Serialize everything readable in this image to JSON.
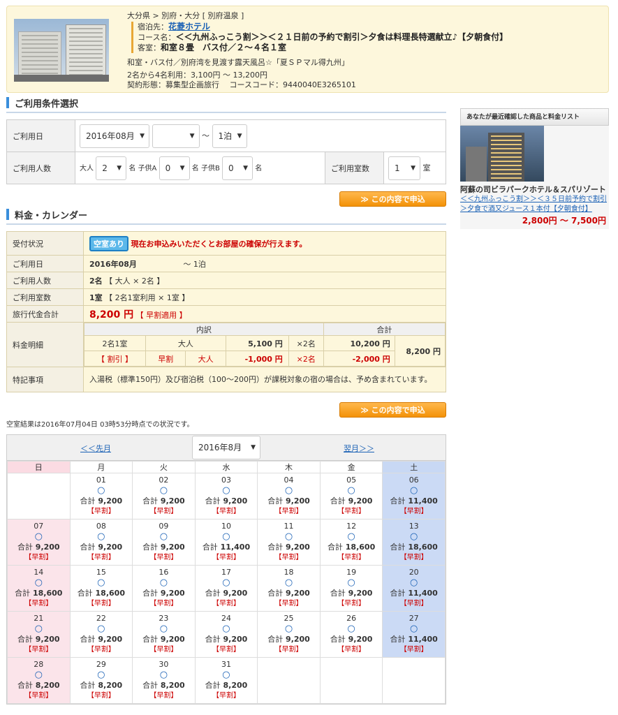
{
  "header": {
    "breadcrumb": "大分県 > 別府・大分 [ 別府温泉 ]",
    "hotel_label": "宿泊先：",
    "hotel_name": "花菱ホテル",
    "course_label": "コース名：",
    "course_name": "＜＜九州ふっこう割＞＞＜２１日前の予約で割引＞夕食は料理長特選献立♪【夕朝食付】",
    "room_label": "客室：",
    "room_name": "和室８畳　バス付／２～４名１室",
    "room_desc": "和室・バス付／別府湾を見渡す露天風呂☆「夏ＳＰマル得九州」",
    "price_range": "2名から4名利用：3,100円 ～ 13,200円",
    "contract": "契約形態：募集型企画旅行　 コースコード：9440040E3265101"
  },
  "conditions": {
    "title": "ご利用条件選択",
    "date_label": "ご利用日",
    "month_value": "2016年08月",
    "day_value": "",
    "tilde": "～",
    "nights_value": "1泊",
    "people_label": "ご利用人数",
    "adult_label": "大人",
    "adult_value": "2",
    "childA_label": "子供A",
    "childA_value": "0",
    "childB_label": "子供B",
    "childB_value": "0",
    "unit_name": "名",
    "rooms_label": "ご利用室数",
    "rooms_value": "1",
    "unit_room": "室",
    "apply_label": "この内容で申込"
  },
  "fee": {
    "title": "料金・カレンダー",
    "status_label": "受付状況",
    "vacant_badge": "空室あり",
    "status_text": "現在お申込みいただくとお部屋の確保が行えます。",
    "date_label": "ご利用日",
    "date_value": "2016年08月",
    "date_suffix": "～ 1泊",
    "people_label": "ご利用人数",
    "people_value": "2名",
    "people_detail": "【 大人 × 2名 】",
    "rooms_label": "ご利用室数",
    "rooms_value": "1室",
    "rooms_detail": "【 2名1室利用 × 1室 】",
    "total_label": "旅行代金合計",
    "total_value": "8,200 円",
    "total_note": "【 早割適用 】",
    "breakdown_label": "料金明細",
    "breakdown_header": "内訳",
    "sum_header": "合計",
    "row1": [
      "2名1室",
      "大人",
      "5,100 円",
      "×2名",
      "10,200 円"
    ],
    "row2": [
      "【 割引 】",
      "早割",
      "大人",
      "-1,000 円",
      "×2名",
      "-2,000 円"
    ],
    "grand_total": "8,200 円",
    "notes_label": "特記事項",
    "notes_text": "入湯税（標準150円）及び宿泊税（100～200円）が課税対象の宿の場合は、予め含まれています。"
  },
  "status_note": "空室結果は2016年07月04日 03時53分時点での状況です。",
  "calendar": {
    "prev": "＜＜先月",
    "next": "翌月＞＞",
    "month": "2016年8月",
    "weekdays": [
      "日",
      "月",
      "火",
      "水",
      "木",
      "金",
      "土"
    ],
    "avail": "○",
    "early": "【早割】",
    "total_prefix": "合計",
    "days": [
      {
        "d": "",
        "t": ""
      },
      {
        "d": "01",
        "t": "9,200"
      },
      {
        "d": "02",
        "t": "9,200"
      },
      {
        "d": "03",
        "t": "9,200"
      },
      {
        "d": "04",
        "t": "9,200"
      },
      {
        "d": "05",
        "t": "9,200"
      },
      {
        "d": "06",
        "t": "11,400"
      },
      {
        "d": "07",
        "t": "9,200"
      },
      {
        "d": "08",
        "t": "9,200"
      },
      {
        "d": "09",
        "t": "9,200"
      },
      {
        "d": "10",
        "t": "11,400"
      },
      {
        "d": "11",
        "t": "9,200"
      },
      {
        "d": "12",
        "t": "18,600"
      },
      {
        "d": "13",
        "t": "18,600"
      },
      {
        "d": "14",
        "t": "18,600"
      },
      {
        "d": "15",
        "t": "18,600"
      },
      {
        "d": "16",
        "t": "9,200"
      },
      {
        "d": "17",
        "t": "9,200"
      },
      {
        "d": "18",
        "t": "9,200"
      },
      {
        "d": "19",
        "t": "9,200"
      },
      {
        "d": "20",
        "t": "11,400"
      },
      {
        "d": "21",
        "t": "9,200"
      },
      {
        "d": "22",
        "t": "9,200"
      },
      {
        "d": "23",
        "t": "9,200"
      },
      {
        "d": "24",
        "t": "9,200"
      },
      {
        "d": "25",
        "t": "9,200"
      },
      {
        "d": "26",
        "t": "9,200"
      },
      {
        "d": "27",
        "t": "11,400"
      },
      {
        "d": "28",
        "t": "8,200"
      },
      {
        "d": "29",
        "t": "8,200"
      },
      {
        "d": "30",
        "t": "8,200"
      },
      {
        "d": "31",
        "t": "8,200"
      },
      {
        "d": "",
        "t": ""
      },
      {
        "d": "",
        "t": ""
      },
      {
        "d": "",
        "t": ""
      }
    ]
  },
  "side": {
    "title": "あなたが最近確認した商品と料金リスト",
    "hotel": "阿蘇の司ビラパークホテル＆スパリゾート",
    "link": "＜＜九州ふっこう割＞＞＜３５日前予約で割引＞夕食で酒又ジュース１本付【夕朝食付】",
    "price": "2,800円 ～ 7,500円"
  }
}
